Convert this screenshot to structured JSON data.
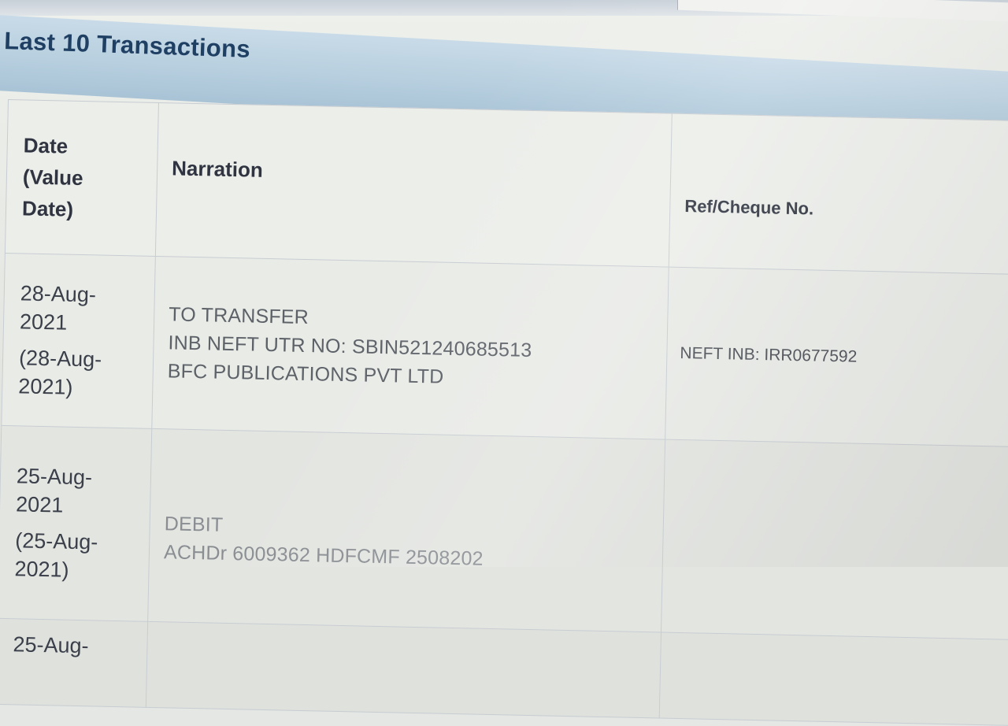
{
  "panel": {
    "title": "Last 10 Transactions"
  },
  "table": {
    "headers": {
      "date": [
        "Date",
        "(Value",
        "Date)"
      ],
      "narration": "Narration",
      "ref": "Ref/Cheque No."
    },
    "rows": [
      {
        "date": [
          "28-Aug-",
          "2021"
        ],
        "value_date": [
          "(28-Aug-",
          "2021)"
        ],
        "narration": [
          "TO TRANSFER",
          "INB NEFT UTR NO: SBIN521240685513",
          "BFC PUBLICATIONS PVT LTD"
        ],
        "ref": "NEFT INB: IRR0677592"
      },
      {
        "date": [
          "25-Aug-",
          "2021"
        ],
        "value_date": [
          "(25-Aug-",
          "2021)"
        ],
        "narration": [
          "DEBIT",
          "ACHDr 6009362 HDFCMF 2508202"
        ],
        "ref": ""
      },
      {
        "date": [
          "25-Aug-"
        ],
        "value_date": [],
        "narration": [],
        "ref": ""
      }
    ]
  },
  "colors": {
    "title": "#1f3f63",
    "header_band": "#b7cfdf",
    "text": "#3b3f4a"
  }
}
